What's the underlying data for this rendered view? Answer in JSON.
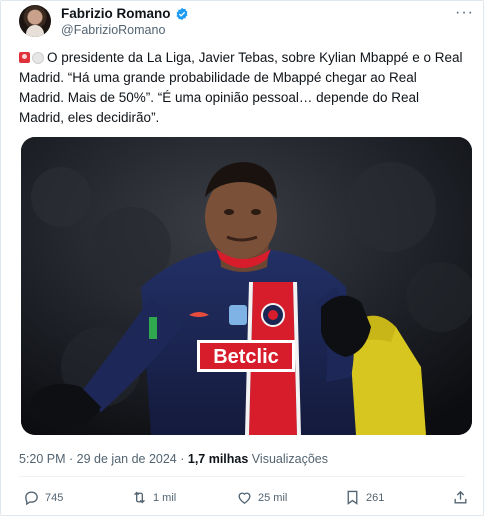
{
  "author": {
    "name": "Fabrizio Romano",
    "handle": "@FabrizioRomano"
  },
  "tweet": {
    "text": "O presidente da La Liga, Javier Tebas, sobre Kylian Mbappé e o Real Madrid. “Há uma grande probabilidade de Mbappé chegar ao Real Madrid. Mais de 50%”. “É uma opinião pessoal… depende do Real Madrid, eles decidirão”.",
    "image_jersey_text": "Betclic"
  },
  "meta": {
    "time": "5:20 PM",
    "sep1": " · ",
    "date": "29 de jan de 2024",
    "sep2": " · ",
    "views_count": "1,7 milhas",
    "views_label": " Visualizações"
  },
  "actions": {
    "replies": "745",
    "reposts": "1 mil",
    "likes": "25 mil",
    "bookmarks": "261"
  },
  "colors": {
    "verified": "#1d9bf0",
    "muted_text": "#536471",
    "jersey_navy": "#1b2553",
    "jersey_red": "#d71c2b"
  },
  "icons": {
    "more": "more-dots-icon",
    "reply": "reply-icon",
    "repost": "repost-icon",
    "like": "heart-icon",
    "bookmark": "bookmark-icon",
    "share": "share-icon"
  }
}
